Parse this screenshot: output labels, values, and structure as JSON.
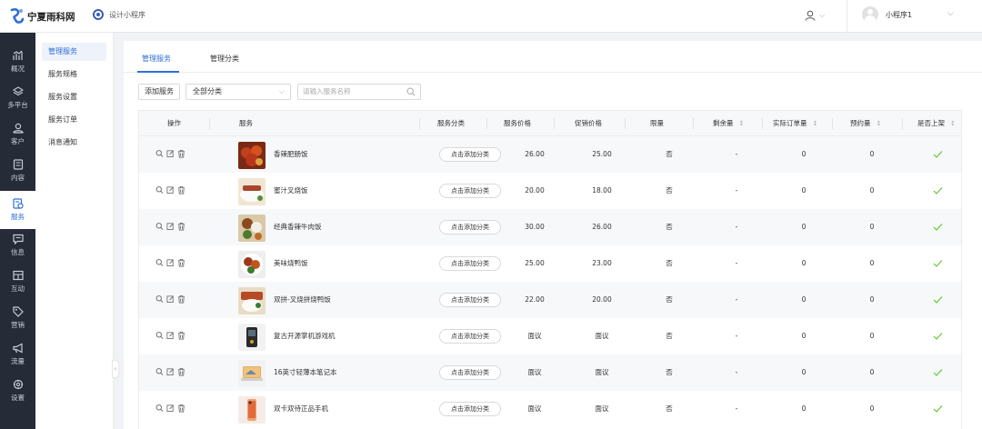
{
  "brand": {
    "name": "宁夏雨科网",
    "colors": {
      "primary": "#2f6fd6",
      "sidebar": "#262b38",
      "check": "#52c41a"
    }
  },
  "header": {
    "design_label": "设计小程序",
    "account_name": "小程序1"
  },
  "nav": [
    {
      "label": "概况",
      "icon": "chart-icon"
    },
    {
      "label": "多平台",
      "icon": "layers-icon"
    },
    {
      "label": "客户",
      "icon": "user-icon"
    },
    {
      "label": "内容",
      "icon": "document-icon"
    },
    {
      "label": "服务",
      "icon": "service-icon",
      "active": true
    },
    {
      "label": "信息",
      "icon": "message-icon"
    },
    {
      "label": "互动",
      "icon": "interact-icon"
    },
    {
      "label": "营销",
      "icon": "tag-icon"
    },
    {
      "label": "流量",
      "icon": "megaphone-icon"
    },
    {
      "label": "设置",
      "icon": "gear-icon"
    }
  ],
  "submenu": [
    {
      "label": "管理服务",
      "active": true
    },
    {
      "label": "服务规格"
    },
    {
      "label": "服务设置"
    },
    {
      "label": "服务订单"
    },
    {
      "label": "消息通知"
    }
  ],
  "tabs": [
    {
      "label": "管理服务",
      "active": true
    },
    {
      "label": "管理分类"
    }
  ],
  "toolbar": {
    "add_label": "添加服务",
    "category_value": "全部分类",
    "search_placeholder": "请输入服务名称"
  },
  "table": {
    "columns": [
      "操作",
      "服务",
      "服务分类",
      "服务价格",
      "促销价格",
      "限量",
      "剩余量",
      "实际订单量",
      "预约量",
      "是否上架"
    ],
    "rows": [
      {
        "name": "香辣肥肠饭",
        "category": "点击添加分类",
        "price": "26.00",
        "promo": "25.00",
        "limit": "否",
        "remain": "-",
        "orders": "0",
        "booked": "0",
        "thumb": "food-red"
      },
      {
        "name": "蜜汁叉烧饭",
        "category": "点击添加分类",
        "price": "20.00",
        "promo": "18.00",
        "limit": "否",
        "remain": "-",
        "orders": "0",
        "booked": "0",
        "thumb": "food-rice"
      },
      {
        "name": "经典香辣牛肉饭",
        "category": "点击添加分类",
        "price": "30.00",
        "promo": "26.00",
        "limit": "否",
        "remain": "-",
        "orders": "0",
        "booked": "0",
        "thumb": "food-beef"
      },
      {
        "name": "美味烧鸭饭",
        "category": "点击添加分类",
        "price": "25.00",
        "promo": "23.00",
        "limit": "否",
        "remain": "-",
        "orders": "0",
        "booked": "0",
        "thumb": "food-duck"
      },
      {
        "name": "双拼-叉烧拼烧鸭饭",
        "category": "点击添加分类",
        "price": "22.00",
        "promo": "20.00",
        "limit": "否",
        "remain": "-",
        "orders": "0",
        "booked": "0",
        "thumb": "food-combo"
      },
      {
        "name": "复古开源掌机游戏机",
        "category": "点击添加分类",
        "price": "面议",
        "promo": "面议",
        "limit": "否",
        "remain": "-",
        "orders": "0",
        "booked": "0",
        "thumb": "console"
      },
      {
        "name": "16英寸轻薄本笔记本",
        "category": "点击添加分类",
        "price": "面议",
        "promo": "面议",
        "limit": "否",
        "remain": "-",
        "orders": "0",
        "booked": "0",
        "thumb": "laptop"
      },
      {
        "name": "双卡双待正品手机",
        "category": "点击添加分类",
        "price": "面议",
        "promo": "面议",
        "limit": "否",
        "remain": "-",
        "orders": "0",
        "booked": "0",
        "thumb": "phone"
      }
    ]
  }
}
